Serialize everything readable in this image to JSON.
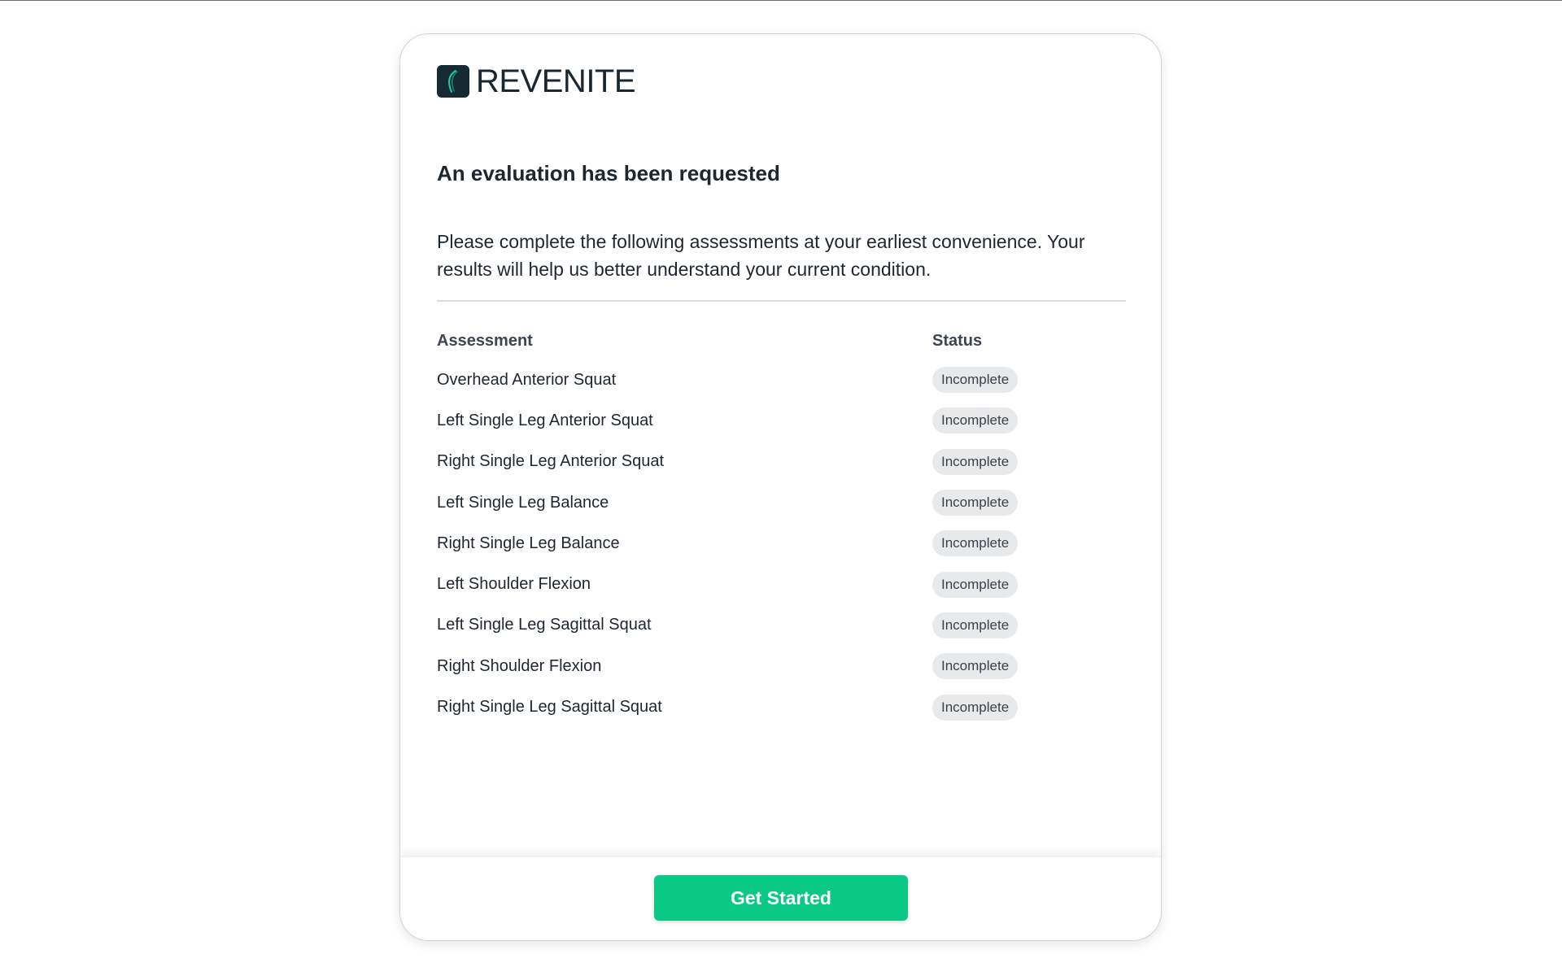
{
  "brand": {
    "name": "REVENITE",
    "logo_color": "#162a33",
    "logo_accent": "#1fd1a0"
  },
  "header": {
    "title": "An evaluation has been requested"
  },
  "intro": {
    "text": "Please complete the following assessments at your earliest convenience. Your results will help us better understand your current condition."
  },
  "table": {
    "columns": [
      "Assessment",
      "Status"
    ],
    "rows": [
      {
        "assessment": "Overhead Anterior Squat",
        "status": "Incomplete"
      },
      {
        "assessment": "Left Single Leg Anterior Squat",
        "status": "Incomplete"
      },
      {
        "assessment": "Right Single Leg Anterior Squat",
        "status": "Incomplete"
      },
      {
        "assessment": "Left Single Leg Balance",
        "status": "Incomplete"
      },
      {
        "assessment": "Right Single Leg Balance",
        "status": "Incomplete"
      },
      {
        "assessment": "Left Shoulder Flexion",
        "status": "Incomplete"
      },
      {
        "assessment": "Left Single Leg Sagittal Squat",
        "status": "Incomplete"
      },
      {
        "assessment": "Right Shoulder Flexion",
        "status": "Incomplete"
      },
      {
        "assessment": "Right Single Leg Sagittal Squat",
        "status": "Incomplete"
      }
    ]
  },
  "footer": {
    "cta_label": "Get Started",
    "cta_color": "#0ac987"
  }
}
